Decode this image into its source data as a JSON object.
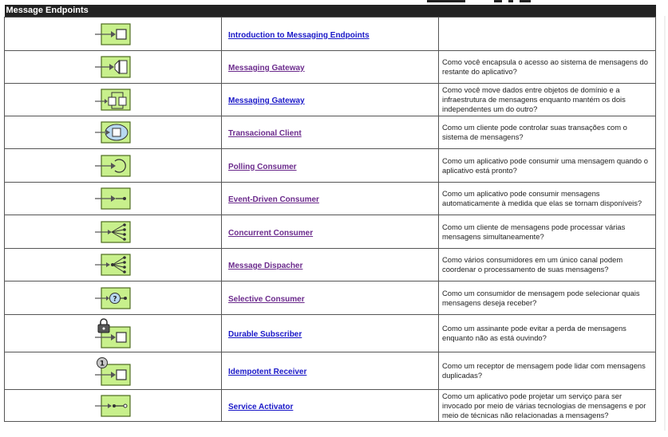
{
  "header": {
    "title": "Message Endpoints"
  },
  "colors": {
    "header_bg": "#222222",
    "icon_fill": "#c8f08c",
    "icon_stroke": "#4d6a1f",
    "link_blue": "#1a18c8",
    "link_visited": "#6b2a8c"
  },
  "rows": [
    {
      "icon": "messaging-endpoint-icon",
      "name": "Introduction to Messaging Endpoints",
      "link_state": "unvisited",
      "description": ""
    },
    {
      "icon": "messaging-gateway-icon",
      "name": "Messaging Gateway",
      "link_state": "visited",
      "description": "Como você encapsula o acesso ao sistema de mensagens do restante do aplicativo?"
    },
    {
      "icon": "messaging-mapper-icon",
      "name": "Messaging Gateway",
      "link_state": "unvisited",
      "description": "Como você move dados entre objetos de domínio e a infraestrutura de mensagens enquanto mantém os dois independentes um do outro?"
    },
    {
      "icon": "transactional-client-icon",
      "name": "Transacional Client",
      "link_state": "visited",
      "description": "Como um cliente pode controlar suas transações com o sistema de mensagens?"
    },
    {
      "icon": "polling-consumer-icon",
      "name": "Polling Consumer",
      "link_state": "visited",
      "description": "Como um aplicativo pode consumir uma mensagem quando o aplicativo está pronto?"
    },
    {
      "icon": "event-driven-consumer-icon",
      "name": "Event-Driven Consumer",
      "link_state": "visited",
      "description": "Como um aplicativo pode consumir mensagens automaticamente à medida que elas se tornam disponíveis?"
    },
    {
      "icon": "concurrent-consumer-icon",
      "name": "Concurrent Consumer",
      "link_state": "visited",
      "description": "Como um cliente de mensagens pode processar várias mensagens simultaneamente?"
    },
    {
      "icon": "message-dispatcher-icon",
      "name": "Message Dispacher",
      "link_state": "visited",
      "description": "Como vários consumidores em um único canal podem coordenar o processamento de suas mensagens?"
    },
    {
      "icon": "selective-consumer-icon",
      "name": "Selective Consumer",
      "link_state": "visited",
      "description": "Como um consumidor de mensagem pode selecionar quais mensagens deseja receber?"
    },
    {
      "icon": "durable-subscriber-icon",
      "name": "Durable Subscriber",
      "link_state": "unvisited",
      "description": "Como um assinante pode evitar a perda de mensagens enquanto não as está ouvindo?"
    },
    {
      "icon": "idempotent-receiver-icon",
      "name": "Idempotent Receiver",
      "link_state": "unvisited",
      "description": "Como um receptor de mensagem pode lidar com mensagens duplicadas?"
    },
    {
      "icon": "service-activator-icon",
      "name": "Service Activator",
      "link_state": "unvisited",
      "description": "Como um aplicativo pode projetar um serviço para ser invocado por meio de várias tecnologias de mensagens e por meio de técnicas não relacionadas a mensagens?"
    }
  ]
}
